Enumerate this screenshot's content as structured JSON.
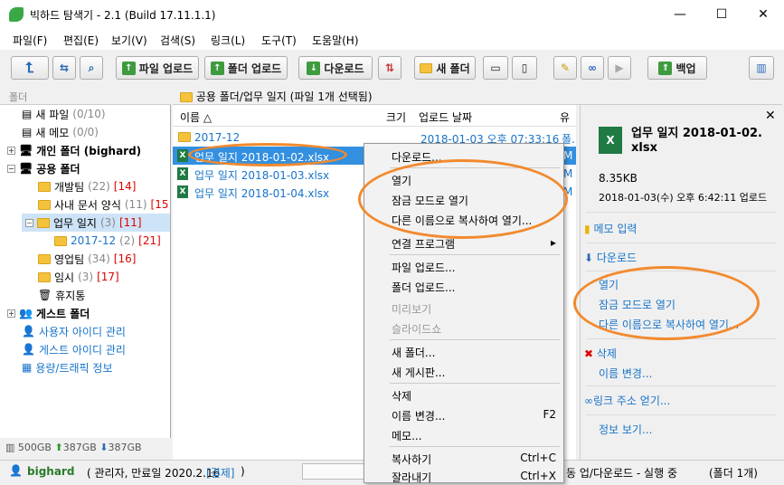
{
  "window": {
    "title": "빅하드 탐색기 - 2.1 (Build 17.11.1.1)",
    "minimize": "—",
    "maximize": "☐",
    "close": "✕"
  },
  "menu": [
    "파일(F)",
    "편집(E)",
    "보기(V)",
    "검색(S)",
    "링크(L)",
    "도구(T)",
    "도움말(H)"
  ],
  "toolbar": {
    "file_upload": "파일 업로드",
    "folder_upload": "폴더 업로드",
    "download": "다운로드",
    "new_folder": "새 폴더",
    "backup": "백업"
  },
  "left": {
    "header": "폴더",
    "items": [
      {
        "label": "새 파일",
        "count": "(0/10)"
      },
      {
        "label": "새 메모",
        "count": "(0/0)"
      },
      {
        "label": "개인 폴더 (bighard)"
      },
      {
        "label": "공용 폴더"
      },
      {
        "label": "개발팀",
        "count": "(22)",
        "badge": "[14]"
      },
      {
        "label": "사내 문서 양식",
        "count": "(11)",
        "badge": "[15"
      },
      {
        "label": "업무 일지",
        "count": "(3)",
        "badge": "[11]"
      },
      {
        "label": "2017-12",
        "count": "(2)",
        "badge": "[21]"
      },
      {
        "label": "영업팀",
        "count": "(34)",
        "badge": "[16]"
      },
      {
        "label": "임시",
        "count": "(3)",
        "badge": "[17]"
      },
      {
        "label": "휴지통"
      },
      {
        "label": "게스트 폴더"
      },
      {
        "label": "사용자 아이디 관리"
      },
      {
        "label": "게스트 아이디 관리"
      },
      {
        "label": "용량/트래픽 정보"
      }
    ],
    "storage": {
      "total": "500GB",
      "up": "387GB",
      "down": "387GB"
    }
  },
  "path": "공용 폴더/업무 일지 (파일 1개 선택됨)",
  "filelist": {
    "headers": {
      "name": "이름 △",
      "size": "크기",
      "date": "업로드 날짜",
      "extra": "유"
    },
    "rows": [
      {
        "name": "2017-12",
        "date": "2018-01-03 오후 07:33:16",
        "extra": "폴."
      },
      {
        "name": "업무 일지 2018-01-02.xlsx",
        "extra": "M"
      },
      {
        "name": "업무 일지 2018-01-03.xlsx",
        "extra": "M"
      },
      {
        "name": "업무 일지 2018-01-04.xlsx",
        "extra": "M"
      }
    ]
  },
  "context": {
    "download": "다운로드...",
    "open": "열기",
    "open_lock": "잠금 모드로 열기",
    "open_copy": "다른 이름으로 복사하여 열기...",
    "open_with": "연결 프로그램",
    "file_upload": "파일 업로드...",
    "folder_upload": "폴더 업로드...",
    "preview": "미리보기",
    "slideshow": "슬라이드쇼",
    "new_folder": "새 폴더...",
    "new_board": "새 게시판...",
    "delete": "삭제",
    "rename": "이름 변경...",
    "rename_sc": "F2",
    "memo": "메모...",
    "copy": "복사하기",
    "copy_sc": "Ctrl+C",
    "cut": "잘라내기",
    "cut_sc": "Ctrl+X"
  },
  "right": {
    "filename": "업무 일지 2018-01-02.",
    "filename2": "xlsx",
    "size": "8.35KB",
    "uploaded": "2018-01-03(수) 오후 6:42:11 업로드",
    "memo": "메모 입력",
    "download": "다운로드",
    "open": "열기",
    "open_lock": "잠금 모드로 열기",
    "open_copy": "다른 이름으로 복사하여 열기...",
    "delete": "삭제",
    "rename": "이름 변경...",
    "link": "링크 주소 얻기...",
    "info": "정보 보기..."
  },
  "status": {
    "user": "bighard",
    "role": "( 관리자, 만료일 2020.2.16 ",
    "pay": "[결제]",
    "close": ")",
    "transfer": "동 업/다운로드 - 실행 중",
    "sel": "(폴더 1개)"
  }
}
